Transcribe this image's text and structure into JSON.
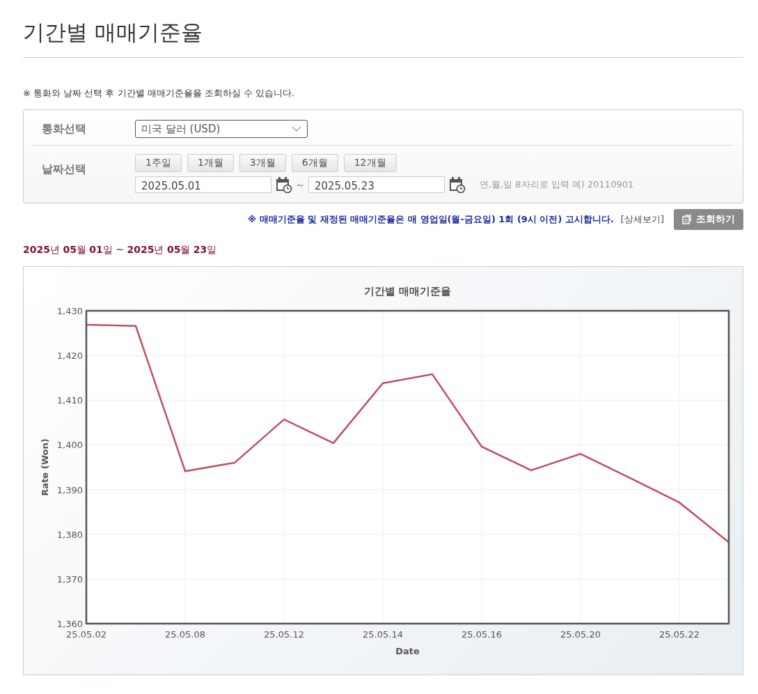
{
  "page_title": "기간별 매매기준율",
  "notice": "※ 통화와 날짜 선택 후 기간별 매매기준율을 조회하실 수 있습니다.",
  "form": {
    "currency": {
      "label": "통화선택",
      "value": "미국 달러 (USD)"
    },
    "date": {
      "label": "날짜선택",
      "period_buttons": [
        "1주일",
        "1개월",
        "3개월",
        "6개월",
        "12개월"
      ],
      "start": "2025.05.01",
      "separator": "~",
      "end": "2025.05.23",
      "hint": "연,월,일 8자리로 입력 예) 20110901"
    }
  },
  "announcement": {
    "text": "※ 매매기준율 및 재정된 매매기준율은 매 영업일(월-금요일) 1회 (9시 이전) 고시합니다.",
    "link": "[상세보기]"
  },
  "search_button": "조회하기",
  "range": "**2025**년 **05**월 **01**일 ~ **2025**년 **05**월 **23**일",
  "chart": {
    "chart_data": {
      "type": "line",
      "title": "기간별 매매기준율",
      "xlabel": "Date",
      "ylabel": "Rate (Won)",
      "categories": [
        "25.05.02",
        null,
        "25.05.08",
        null,
        "25.05.12",
        null,
        "25.05.14",
        null,
        "25.05.16",
        null,
        "25.05.20",
        null,
        "25.05.22",
        null
      ],
      "grid": true,
      "series": [
        {
          "color": "#c0505e",
          "values": [
            1426.9,
            1426.6,
            1394.1,
            1396.0,
            1405.7,
            1400.4,
            1413.8,
            1415.8,
            1399.6,
            1394.3,
            1398.0,
            1392.6,
            1387.1,
            1378.2
          ]
        }
      ],
      "ylim": [
        1360,
        1430
      ],
      "yticks": [
        {
          "value": 1360,
          "label": "1,360"
        },
        {
          "value": 1370,
          "label": "1,370"
        },
        {
          "value": 1380,
          "label": "1,380"
        },
        {
          "value": 1390,
          "label": "1,390"
        },
        {
          "value": 1400,
          "label": "1,400"
        },
        {
          "value": 1410,
          "label": "1,410"
        },
        {
          "value": 1420,
          "label": "1,420"
        },
        {
          "value": 1430,
          "label": "1,430"
        }
      ]
    }
  }
}
